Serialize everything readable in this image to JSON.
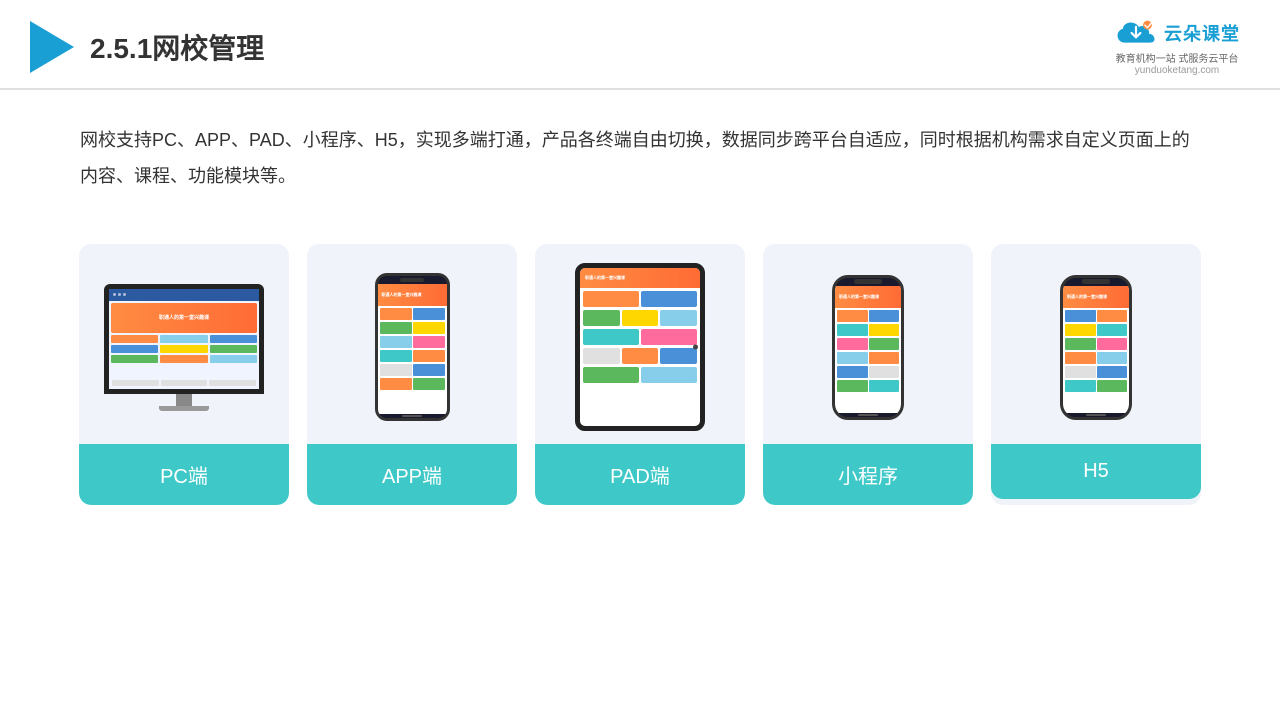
{
  "header": {
    "title": "2.5.1网校管理",
    "brand": {
      "name": "云朵课堂",
      "url": "yunduoketang.com",
      "tagline": "教育机构一站\n式服务云平台"
    }
  },
  "description": {
    "text": "网校支持PC、APP、PAD、小程序、H5，实现多端打通，产品各终端自由切换，数据同步跨平台自适应，同时根据机构需求自定义页面上的内容、课程、功能模块等。"
  },
  "cards": [
    {
      "id": "pc",
      "label": "PC端"
    },
    {
      "id": "app",
      "label": "APP端"
    },
    {
      "id": "pad",
      "label": "PAD端"
    },
    {
      "id": "miniapp",
      "label": "小程序"
    },
    {
      "id": "h5",
      "label": "H5"
    }
  ]
}
